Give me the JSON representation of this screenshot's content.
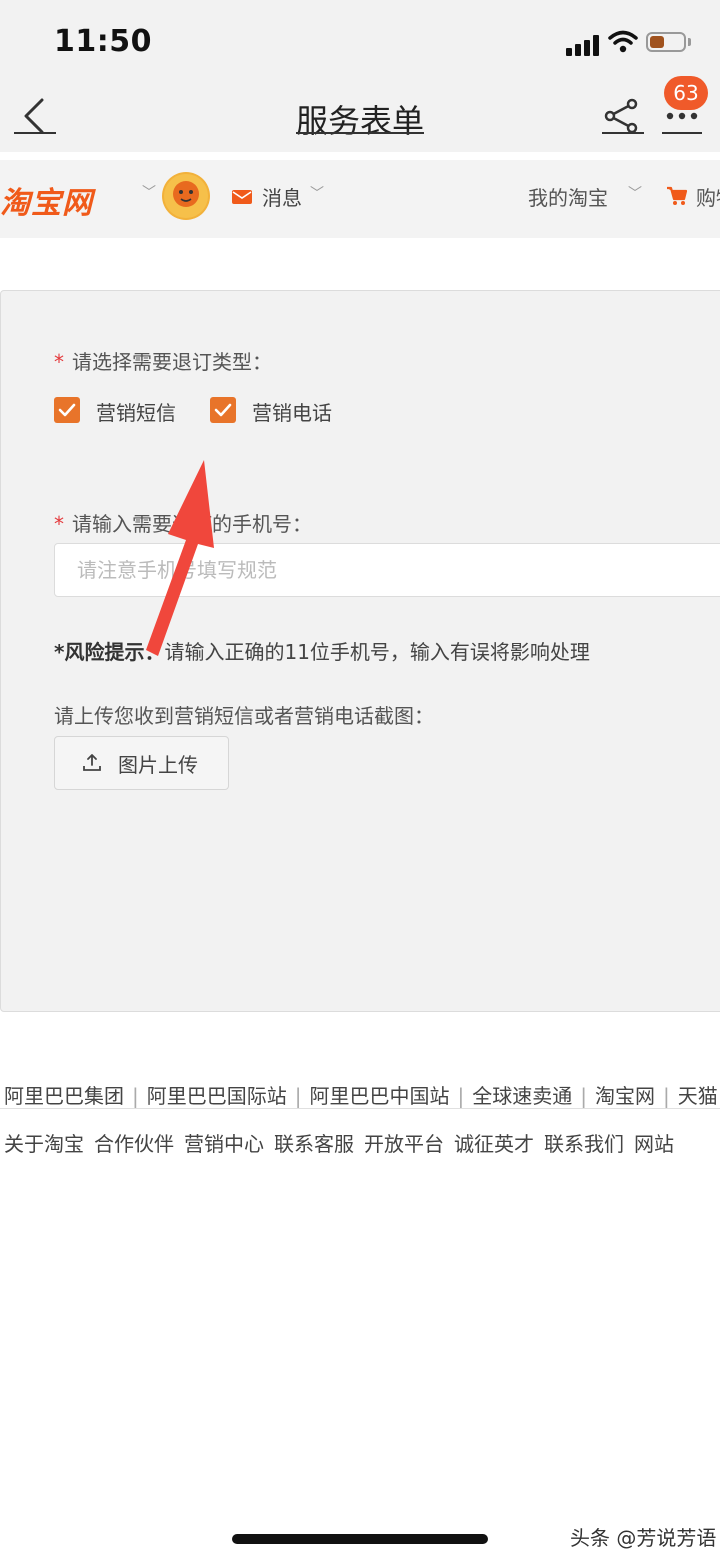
{
  "status_bar": {
    "time": "11:50"
  },
  "nav": {
    "title": "服务表单",
    "badge_count": "63"
  },
  "taobao_bar": {
    "logo_text": "淘宝网",
    "messages_label": "消息",
    "my_taobao_label": "我的淘宝",
    "cart_label": "购物"
  },
  "form": {
    "type_label": "请选择需要退订类型：",
    "options": [
      {
        "label": "营销短信",
        "checked": true
      },
      {
        "label": "营销电话",
        "checked": true
      }
    ],
    "phone_label": "请输入需要退订的手机号：",
    "phone_placeholder": "请注意手机号填写规范",
    "risk_prefix": "*风险提示：",
    "risk_text": "请输入正确的11位手机号，输入有误将影响处理",
    "upload_label": "请上传您收到营销短信或者营销电话截图：",
    "upload_button": "图片上传"
  },
  "footer": {
    "row1": [
      "阿里巴巴集团",
      "阿里巴巴国际站",
      "阿里巴巴中国站",
      "全球速卖通",
      "淘宝网",
      "天猫"
    ],
    "row2": [
      "关于淘宝",
      "合作伙伴",
      "营销中心",
      "联系客服",
      "开放平台",
      "诚征英才",
      "联系我们",
      "网站"
    ]
  },
  "watermark": "头条 @芳说芳语",
  "colors": {
    "accent": "#e8742a",
    "brand": "#f05a1a",
    "badge": "#f05a2a",
    "arrow": "#f0473c"
  }
}
